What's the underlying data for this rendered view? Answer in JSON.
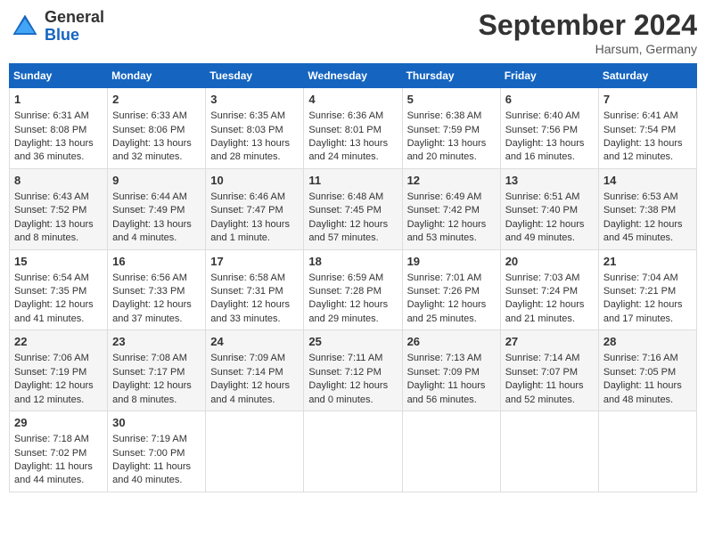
{
  "header": {
    "logo_line1": "General",
    "logo_line2": "Blue",
    "month": "September 2024",
    "location": "Harsum, Germany"
  },
  "days_of_week": [
    "Sunday",
    "Monday",
    "Tuesday",
    "Wednesday",
    "Thursday",
    "Friday",
    "Saturday"
  ],
  "weeks": [
    [
      {
        "day": 1,
        "lines": [
          "Sunrise: 6:31 AM",
          "Sunset: 8:08 PM",
          "Daylight: 13 hours",
          "and 36 minutes."
        ]
      },
      {
        "day": 2,
        "lines": [
          "Sunrise: 6:33 AM",
          "Sunset: 8:06 PM",
          "Daylight: 13 hours",
          "and 32 minutes."
        ]
      },
      {
        "day": 3,
        "lines": [
          "Sunrise: 6:35 AM",
          "Sunset: 8:03 PM",
          "Daylight: 13 hours",
          "and 28 minutes."
        ]
      },
      {
        "day": 4,
        "lines": [
          "Sunrise: 6:36 AM",
          "Sunset: 8:01 PM",
          "Daylight: 13 hours",
          "and 24 minutes."
        ]
      },
      {
        "day": 5,
        "lines": [
          "Sunrise: 6:38 AM",
          "Sunset: 7:59 PM",
          "Daylight: 13 hours",
          "and 20 minutes."
        ]
      },
      {
        "day": 6,
        "lines": [
          "Sunrise: 6:40 AM",
          "Sunset: 7:56 PM",
          "Daylight: 13 hours",
          "and 16 minutes."
        ]
      },
      {
        "day": 7,
        "lines": [
          "Sunrise: 6:41 AM",
          "Sunset: 7:54 PM",
          "Daylight: 13 hours",
          "and 12 minutes."
        ]
      }
    ],
    [
      {
        "day": 8,
        "lines": [
          "Sunrise: 6:43 AM",
          "Sunset: 7:52 PM",
          "Daylight: 13 hours",
          "and 8 minutes."
        ]
      },
      {
        "day": 9,
        "lines": [
          "Sunrise: 6:44 AM",
          "Sunset: 7:49 PM",
          "Daylight: 13 hours",
          "and 4 minutes."
        ]
      },
      {
        "day": 10,
        "lines": [
          "Sunrise: 6:46 AM",
          "Sunset: 7:47 PM",
          "Daylight: 13 hours",
          "and 1 minute."
        ]
      },
      {
        "day": 11,
        "lines": [
          "Sunrise: 6:48 AM",
          "Sunset: 7:45 PM",
          "Daylight: 12 hours",
          "and 57 minutes."
        ]
      },
      {
        "day": 12,
        "lines": [
          "Sunrise: 6:49 AM",
          "Sunset: 7:42 PM",
          "Daylight: 12 hours",
          "and 53 minutes."
        ]
      },
      {
        "day": 13,
        "lines": [
          "Sunrise: 6:51 AM",
          "Sunset: 7:40 PM",
          "Daylight: 12 hours",
          "and 49 minutes."
        ]
      },
      {
        "day": 14,
        "lines": [
          "Sunrise: 6:53 AM",
          "Sunset: 7:38 PM",
          "Daylight: 12 hours",
          "and 45 minutes."
        ]
      }
    ],
    [
      {
        "day": 15,
        "lines": [
          "Sunrise: 6:54 AM",
          "Sunset: 7:35 PM",
          "Daylight: 12 hours",
          "and 41 minutes."
        ]
      },
      {
        "day": 16,
        "lines": [
          "Sunrise: 6:56 AM",
          "Sunset: 7:33 PM",
          "Daylight: 12 hours",
          "and 37 minutes."
        ]
      },
      {
        "day": 17,
        "lines": [
          "Sunrise: 6:58 AM",
          "Sunset: 7:31 PM",
          "Daylight: 12 hours",
          "and 33 minutes."
        ]
      },
      {
        "day": 18,
        "lines": [
          "Sunrise: 6:59 AM",
          "Sunset: 7:28 PM",
          "Daylight: 12 hours",
          "and 29 minutes."
        ]
      },
      {
        "day": 19,
        "lines": [
          "Sunrise: 7:01 AM",
          "Sunset: 7:26 PM",
          "Daylight: 12 hours",
          "and 25 minutes."
        ]
      },
      {
        "day": 20,
        "lines": [
          "Sunrise: 7:03 AM",
          "Sunset: 7:24 PM",
          "Daylight: 12 hours",
          "and 21 minutes."
        ]
      },
      {
        "day": 21,
        "lines": [
          "Sunrise: 7:04 AM",
          "Sunset: 7:21 PM",
          "Daylight: 12 hours",
          "and 17 minutes."
        ]
      }
    ],
    [
      {
        "day": 22,
        "lines": [
          "Sunrise: 7:06 AM",
          "Sunset: 7:19 PM",
          "Daylight: 12 hours",
          "and 12 minutes."
        ]
      },
      {
        "day": 23,
        "lines": [
          "Sunrise: 7:08 AM",
          "Sunset: 7:17 PM",
          "Daylight: 12 hours",
          "and 8 minutes."
        ]
      },
      {
        "day": 24,
        "lines": [
          "Sunrise: 7:09 AM",
          "Sunset: 7:14 PM",
          "Daylight: 12 hours",
          "and 4 minutes."
        ]
      },
      {
        "day": 25,
        "lines": [
          "Sunrise: 7:11 AM",
          "Sunset: 7:12 PM",
          "Daylight: 12 hours",
          "and 0 minutes."
        ]
      },
      {
        "day": 26,
        "lines": [
          "Sunrise: 7:13 AM",
          "Sunset: 7:09 PM",
          "Daylight: 11 hours",
          "and 56 minutes."
        ]
      },
      {
        "day": 27,
        "lines": [
          "Sunrise: 7:14 AM",
          "Sunset: 7:07 PM",
          "Daylight: 11 hours",
          "and 52 minutes."
        ]
      },
      {
        "day": 28,
        "lines": [
          "Sunrise: 7:16 AM",
          "Sunset: 7:05 PM",
          "Daylight: 11 hours",
          "and 48 minutes."
        ]
      }
    ],
    [
      {
        "day": 29,
        "lines": [
          "Sunrise: 7:18 AM",
          "Sunset: 7:02 PM",
          "Daylight: 11 hours",
          "and 44 minutes."
        ]
      },
      {
        "day": 30,
        "lines": [
          "Sunrise: 7:19 AM",
          "Sunset: 7:00 PM",
          "Daylight: 11 hours",
          "and 40 minutes."
        ]
      },
      null,
      null,
      null,
      null,
      null
    ]
  ]
}
